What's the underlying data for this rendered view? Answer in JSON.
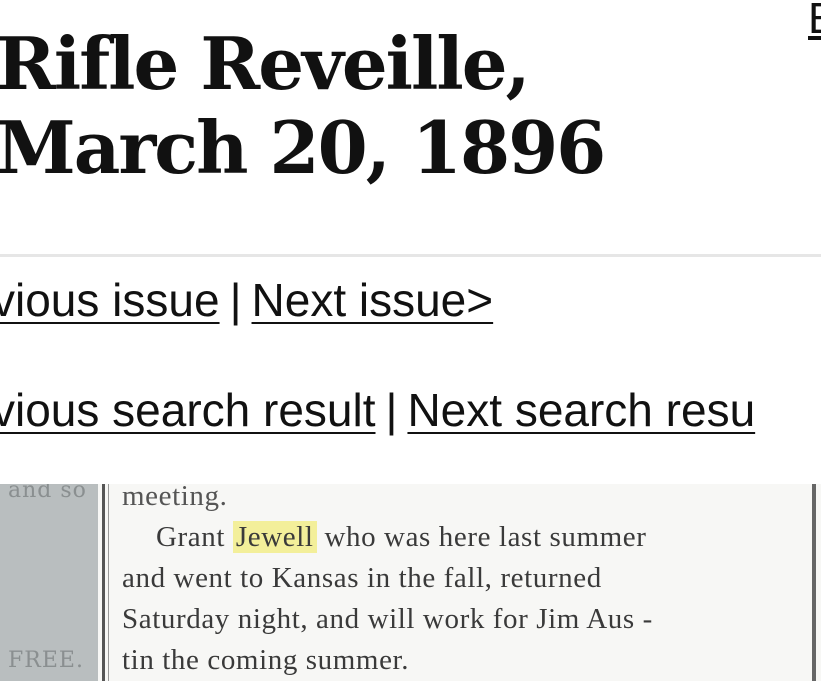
{
  "page": {
    "title": "Rifle Reveille, March 20, 1896",
    "corner_link": "E"
  },
  "nav": {
    "prev_issue": "vious issue",
    "next_issue": "Next issue>",
    "separator": "|",
    "prev_result": "vious search result",
    "next_result": "Next search resu"
  },
  "snippet": {
    "left_top": "and so",
    "left_bottom": "FREE.",
    "top_fragment": "meeting.",
    "line1_pre": "Grant",
    "highlight": "Jewell",
    "line1_post": "who was here last summer",
    "line2": "and went to Kansas in the fall, returned",
    "line3": "Saturday night, and will work for Jim Aus -",
    "line4": "tin the coming summer."
  }
}
